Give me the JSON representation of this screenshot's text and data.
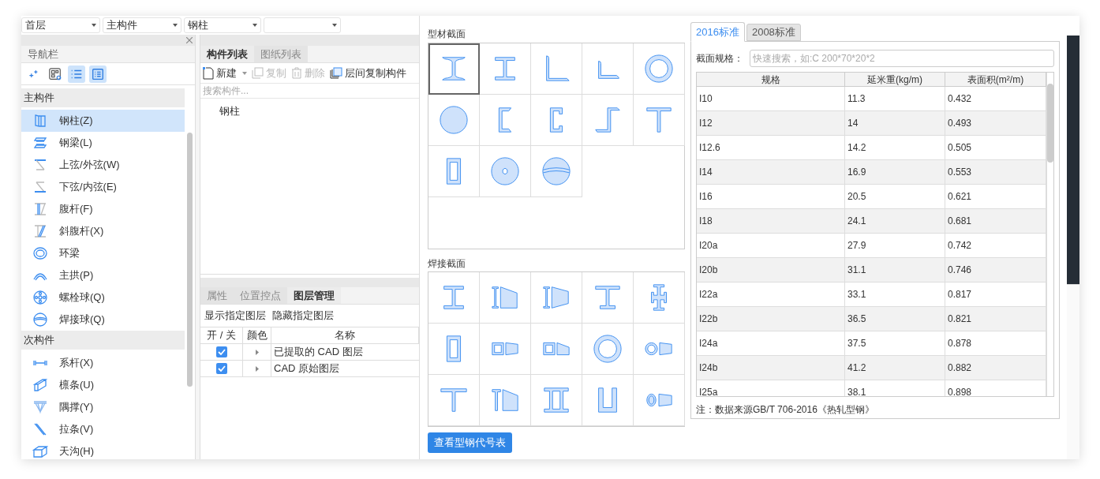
{
  "dropdowns": [
    {
      "kind": "select",
      "value": "首层"
    },
    {
      "kind": "select",
      "value": "主构件"
    },
    {
      "kind": "select",
      "value": "钢柱"
    },
    {
      "kind": "select"
    }
  ],
  "nav": {
    "title": "导航栏",
    "toolbar": [
      {
        "toggled": false
      },
      {
        "toggled": false
      },
      {
        "toggled": true
      },
      {
        "toggled": true
      }
    ],
    "groups": [
      {
        "label": "主构件",
        "items": [
          {
            "label": "钢柱(Z)",
            "selected": true
          },
          {
            "label": "钢梁(L)",
            "selected": false
          },
          {
            "label": "上弦/外弦(W)",
            "selected": false
          },
          {
            "label": "下弦/内弦(E)",
            "selected": false
          },
          {
            "label": "腹杆(F)",
            "selected": false
          },
          {
            "label": "斜腹杆(X)",
            "selected": false
          },
          {
            "label": "环梁",
            "selected": false
          },
          {
            "label": "主拱(P)",
            "selected": false
          },
          {
            "label": "螺栓球(Q)",
            "selected": false
          },
          {
            "label": "焊接球(Q)",
            "selected": false
          }
        ]
      },
      {
        "label": "次构件",
        "items": [
          {
            "label": "系杆(X)",
            "selected": false
          },
          {
            "label": "檩条(U)",
            "selected": false
          },
          {
            "label": "隅撑(Y)",
            "selected": false
          },
          {
            "label": "拉条(V)",
            "selected": false
          },
          {
            "label": "天沟(H)",
            "selected": false
          }
        ]
      }
    ]
  },
  "component_panel": {
    "tabs": [
      {
        "label": "构件列表",
        "selected": true
      },
      {
        "label": "图纸列表",
        "selected": false
      }
    ],
    "toolbar": [
      {
        "label": "新建",
        "disabled": false,
        "dropdown": true
      },
      {
        "label": "复制",
        "disabled": true,
        "dropdown": false
      },
      {
        "label": "删除",
        "disabled": true,
        "dropdown": false
      },
      {
        "label": "层间复制构件",
        "disabled": false,
        "dropdown": false
      }
    ],
    "search": {
      "placeholder": "搜索构件..."
    },
    "items": [
      "钢柱"
    ]
  },
  "layer_panel": {
    "tabs": [
      {
        "label": "属性",
        "selected": false
      },
      {
        "label": "位置控点",
        "selected": false
      },
      {
        "label": "图层管理",
        "selected": true
      }
    ],
    "actions": [
      "显示指定图层",
      "隐藏指定图层"
    ],
    "columns": [
      "开 / 关",
      "颜色",
      "名称"
    ],
    "rows": [
      {
        "checked": true,
        "name": "已提取的 CAD 图层"
      },
      {
        "checked": true,
        "name": "CAD 原始图层"
      }
    ]
  },
  "section_dialog": {
    "profile_title": "型材截面",
    "profile_sections": [
      {
        "selected": true
      },
      {
        "selected": false
      },
      {
        "selected": false
      },
      {
        "selected": false
      },
      {
        "selected": false
      },
      {
        "selected": false
      },
      {
        "selected": false
      },
      {
        "selected": false
      },
      {
        "selected": false
      },
      {
        "selected": false
      },
      {
        "selected": false
      },
      {
        "selected": false
      },
      {
        "selected": false
      }
    ],
    "welded_title": "焊接截面",
    "welded_sections": [
      {
        "selected": false
      },
      {
        "selected": false
      },
      {
        "selected": false
      },
      {
        "selected": false
      },
      {
        "selected": false
      },
      {
        "selected": false
      },
      {
        "selected": false
      },
      {
        "selected": false
      },
      {
        "selected": false
      },
      {
        "selected": false
      },
      {
        "selected": false
      },
      {
        "selected": false
      },
      {
        "selected": false
      },
      {
        "selected": false
      },
      {
        "selected": false
      }
    ],
    "button": "查看型钢代号表",
    "standard_tabs": [
      {
        "label": "2016标准",
        "selected": true
      },
      {
        "label": "2008标准",
        "selected": false
      }
    ],
    "spec_label": "截面规格：",
    "spec_search": {
      "placeholder": "快速搜索，如:C 200*70*20*2"
    },
    "table": {
      "columns": [
        "规格",
        "延米重(kg/m)",
        "表面积(m²/m)"
      ],
      "rows": [
        [
          "I10",
          "11.3",
          "0.432"
        ],
        [
          "I12",
          "14",
          "0.493"
        ],
        [
          "I12.6",
          "14.2",
          "0.505"
        ],
        [
          "I14",
          "16.9",
          "0.553"
        ],
        [
          "I16",
          "20.5",
          "0.621"
        ],
        [
          "I18",
          "24.1",
          "0.681"
        ],
        [
          "I20a",
          "27.9",
          "0.742"
        ],
        [
          "I20b",
          "31.1",
          "0.746"
        ],
        [
          "I22a",
          "33.1",
          "0.817"
        ],
        [
          "I22b",
          "36.5",
          "0.821"
        ],
        [
          "I24a",
          "37.5",
          "0.878"
        ],
        [
          "I24b",
          "41.2",
          "0.882"
        ],
        [
          "I25a",
          "38.1",
          "0.898"
        ]
      ]
    },
    "note": "注：数据来源GB/T 706-2016《热轧型钢》"
  }
}
